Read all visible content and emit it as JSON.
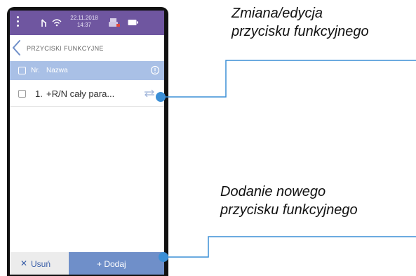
{
  "status_bar": {
    "date": "22.11.2018",
    "time": "14:37",
    "icons": [
      "menu-dots-icon",
      "signal-icon",
      "wifi-icon",
      "printer-icon",
      "battery-icon"
    ]
  },
  "header": {
    "title": "PRZYCISKI FUNKCYJNE"
  },
  "table": {
    "columns": [
      "Nr.",
      "Nazwa"
    ],
    "rows": [
      {
        "number": "1.",
        "name": "+R/N cały para..."
      }
    ]
  },
  "footer": {
    "delete_label": "Usuń",
    "add_label": "+ Dodaj"
  },
  "annotations": {
    "edit_line1": "Zmiana/edycja",
    "edit_line2": "przycisku funkcyjnego",
    "add_line1": "Dodanie nowego",
    "add_line2": "przycisku funkcyjnego"
  },
  "colors": {
    "status_bar": "#6f56a0",
    "table_header": "#a9c0e6",
    "add_button": "#6f8fc9",
    "annotation_line": "#3b8fd6",
    "marker": "#3b8fd6"
  }
}
